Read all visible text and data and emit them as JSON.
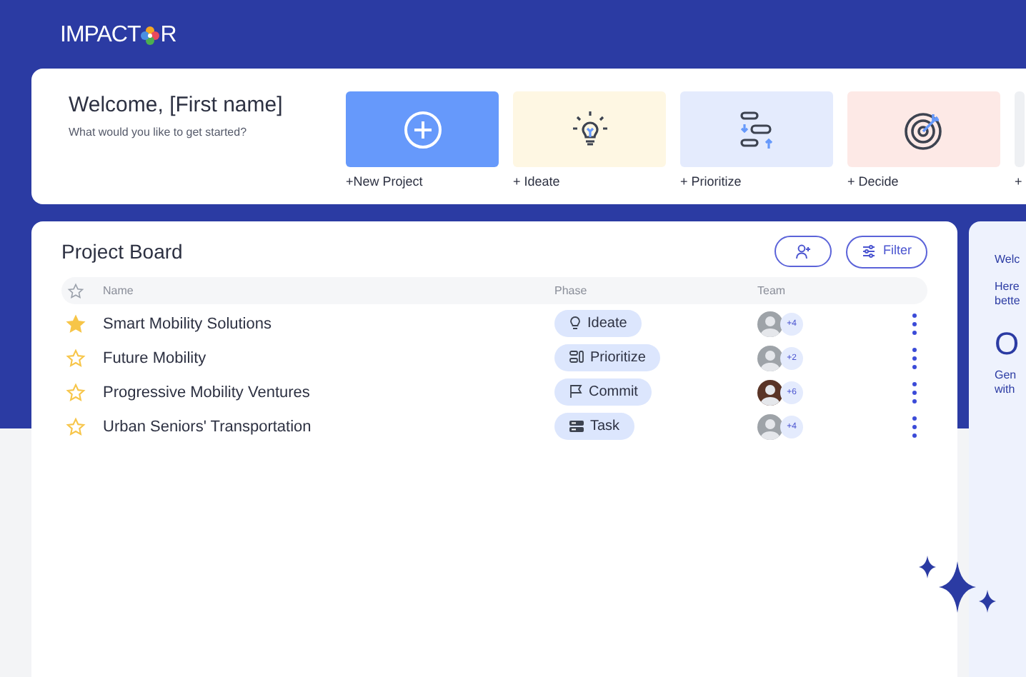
{
  "logo": {
    "before": "IMPACT",
    "after": "R"
  },
  "welcome": {
    "title": "Welcome, [First name]",
    "subtitle": "What would you like to get started?"
  },
  "actions": [
    {
      "kind": "new",
      "label": "+New Project"
    },
    {
      "kind": "ideate",
      "label": "+ Ideate"
    },
    {
      "kind": "prioritize",
      "label": "+ Prioritize"
    },
    {
      "kind": "decide",
      "label": "+ Decide"
    },
    {
      "kind": "other",
      "label": "+"
    }
  ],
  "board": {
    "title": "Project Board",
    "filter_button": "Filter",
    "columns": [
      "Name",
      "Phase",
      "Team"
    ],
    "rows": [
      {
        "starred": true,
        "name": "Smart Mobility Solutions",
        "phase": "Ideate",
        "kind": "ideate",
        "team_extra": "+4"
      },
      {
        "starred": false,
        "name": "Future Mobility",
        "phase": "Prioritize",
        "kind": "prioritize",
        "team_extra": "+2"
      },
      {
        "starred": false,
        "name": "Progressive Mobility Ventures",
        "phase": "Commit",
        "kind": "commit",
        "team_extra": "+6"
      },
      {
        "starred": false,
        "name": "Urban Seniors' Transportation",
        "phase": "Task",
        "kind": "task",
        "team_extra": "+4"
      }
    ]
  },
  "side_panel": {
    "texts": [
      "Welc",
      "Here",
      "bette"
    ],
    "big": "O",
    "footer": [
      "Gen",
      "with"
    ]
  }
}
